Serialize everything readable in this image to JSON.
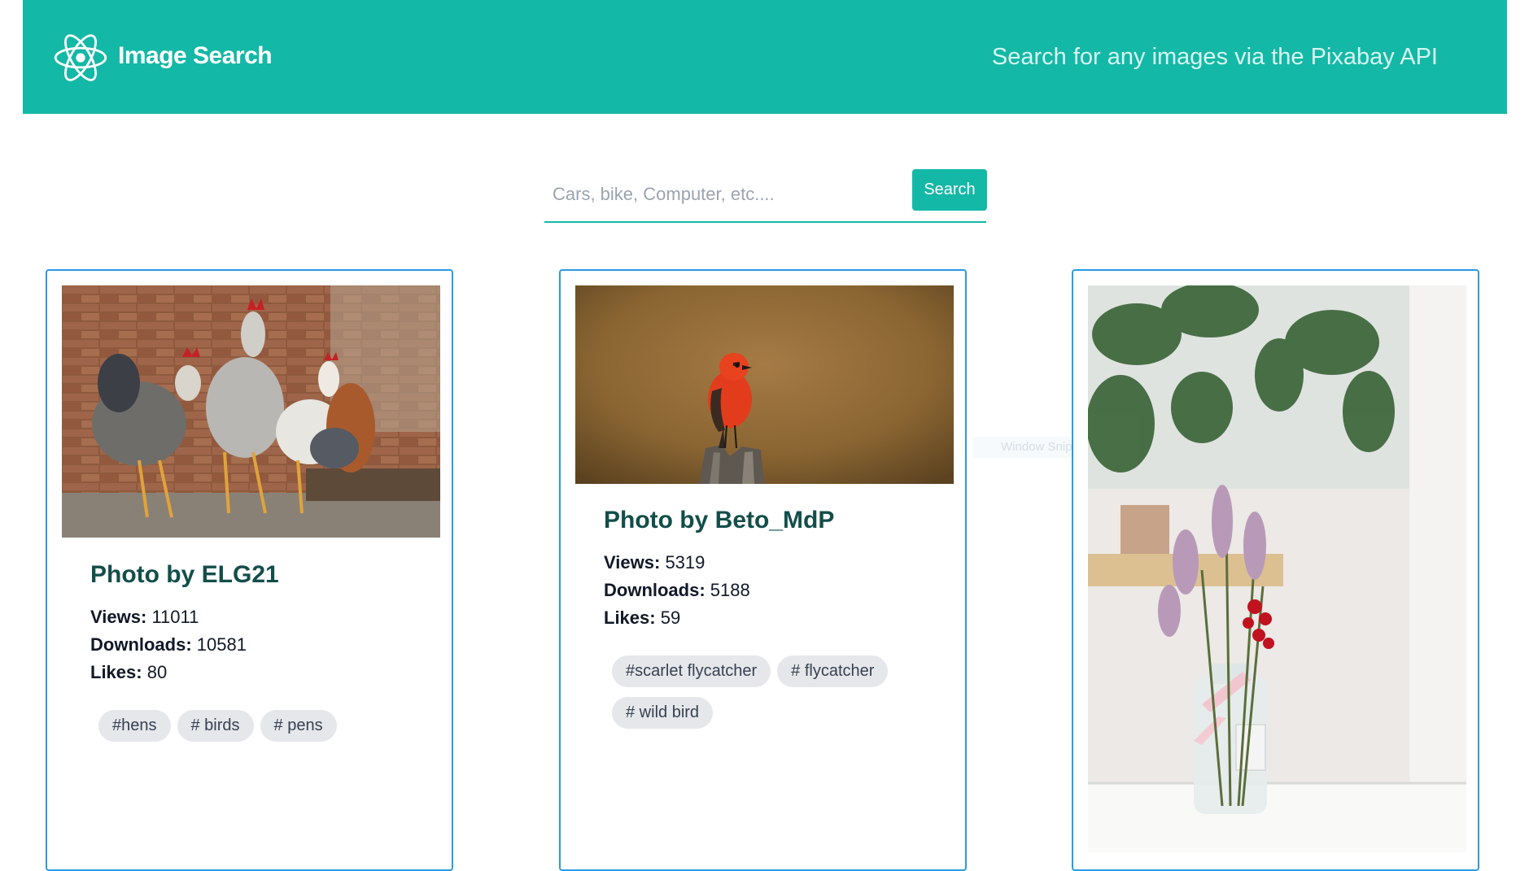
{
  "header": {
    "brand": "Image Search",
    "tagline": "Search for any images via the Pixabay API",
    "logo_icon": "react-atom-icon"
  },
  "search": {
    "placeholder": "Cars, bike, Computer, etc....",
    "value": "",
    "button_label": "Search"
  },
  "cards": [
    {
      "photo_by": "Photo by ELG21",
      "views_label": "Views:",
      "views": "11011",
      "downloads_label": "Downloads:",
      "downloads": "10581",
      "likes_label": "Likes:",
      "likes": "80",
      "tags": [
        "#hens",
        "# birds",
        "# pens"
      ]
    },
    {
      "photo_by": "Photo by Beto_MdP",
      "views_label": "Views:",
      "views": "5319",
      "downloads_label": "Downloads:",
      "downloads": "5188",
      "likes_label": "Likes:",
      "likes": "59",
      "tags": [
        "#scarlet flycatcher",
        "# flycatcher",
        "# wild bird"
      ]
    },
    {
      "photo_by": "",
      "tags": []
    }
  ],
  "overlay": {
    "watermark": "Window Snip"
  },
  "colors": {
    "accent": "#14b8a6",
    "card_border": "#2b9be4",
    "title_text": "#134e4a",
    "tag_bg": "#e5e7eb"
  }
}
